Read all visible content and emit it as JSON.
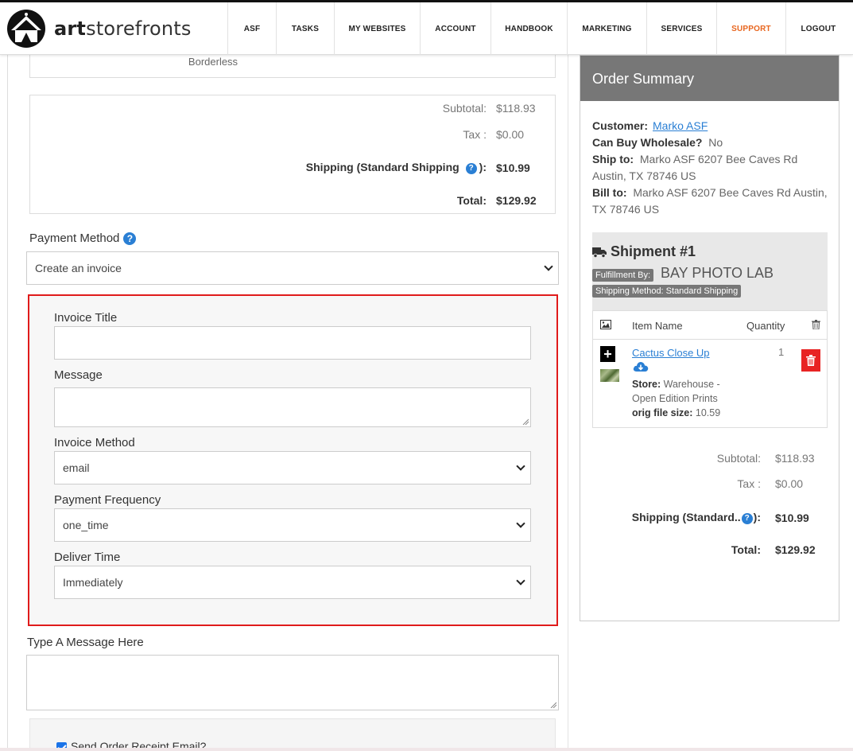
{
  "app": {
    "brand_prefix": "art",
    "brand_suffix": "storefronts"
  },
  "nav": [
    {
      "label": "ASF"
    },
    {
      "label": "TASKS"
    },
    {
      "label": "MY WEBSITES"
    },
    {
      "label": "ACCOUNT"
    },
    {
      "label": "HANDBOOK"
    },
    {
      "label": "MARKETING"
    },
    {
      "label": "SERVICES"
    },
    {
      "label": "SUPPORT",
      "color": "#e8661f"
    },
    {
      "label": "LOGOUT"
    }
  ],
  "order": {
    "borderless_text": "Borderless",
    "totals": {
      "subtotal_label": "Subtotal:",
      "subtotal": "$118.93",
      "tax_label": "Tax :",
      "tax": "$0.00",
      "shipping_label": "Shipping (Standard Shipping",
      "shipping_suffix": "):",
      "shipping": "$10.99",
      "total_label": "Total:",
      "total": "$129.92"
    },
    "payment_method_label": "Payment Method",
    "payment_method_value": "Create an invoice"
  },
  "invoice": {
    "title_label": "Invoice Title",
    "title_value": "",
    "message_label": "Message",
    "message_value": "",
    "method_label": "Invoice Method",
    "method_value": "email",
    "frequency_label": "Payment Frequency",
    "frequency_value": "one_time",
    "deliver_label": "Deliver Time",
    "deliver_value": "Immediately",
    "border_color": "#e01b1b"
  },
  "message": {
    "label": "Type A Message Here",
    "value": ""
  },
  "email_receipt": {
    "label": "Send Order Receipt Email?",
    "checked": true
  },
  "summary": {
    "heading": "Order Summary",
    "customer_label": "Customer:",
    "customer": "Marko ASF",
    "wholesale_label": "Can Buy Wholesale?",
    "wholesale": "No",
    "ship_to_label": "Ship to:",
    "ship_to": "Marko ASF 6207 Bee Caves Rd Austin, TX 78746 US",
    "bill_to_label": "Bill to:",
    "bill_to": "Marko ASF 6207 Bee Caves Rd Austin, TX 78746 US",
    "shipment": {
      "title": "Shipment #1",
      "fulfillment_label": "Fulfillment By:",
      "fulfillment": "BAY PHOTO LAB",
      "method": "Shipping Method: Standard Shipping",
      "col_item": "Item Name",
      "col_qty": "Quantity",
      "item": {
        "name": "Cactus Close Up",
        "store_label": "Store:",
        "store": "Warehouse - Open Edition Prints",
        "file_size_label": "orig file size:",
        "file_size": "10.59",
        "qty": "1"
      }
    },
    "totals": {
      "subtotal_label": "Subtotal:",
      "subtotal": "$118.93",
      "tax_label": "Tax :",
      "tax": "$0.00",
      "shipping_label": "Shipping (Standard..",
      "shipping_suffix": "):",
      "shipping": "$10.99",
      "total_label": "Total:",
      "total": "$129.92"
    }
  }
}
